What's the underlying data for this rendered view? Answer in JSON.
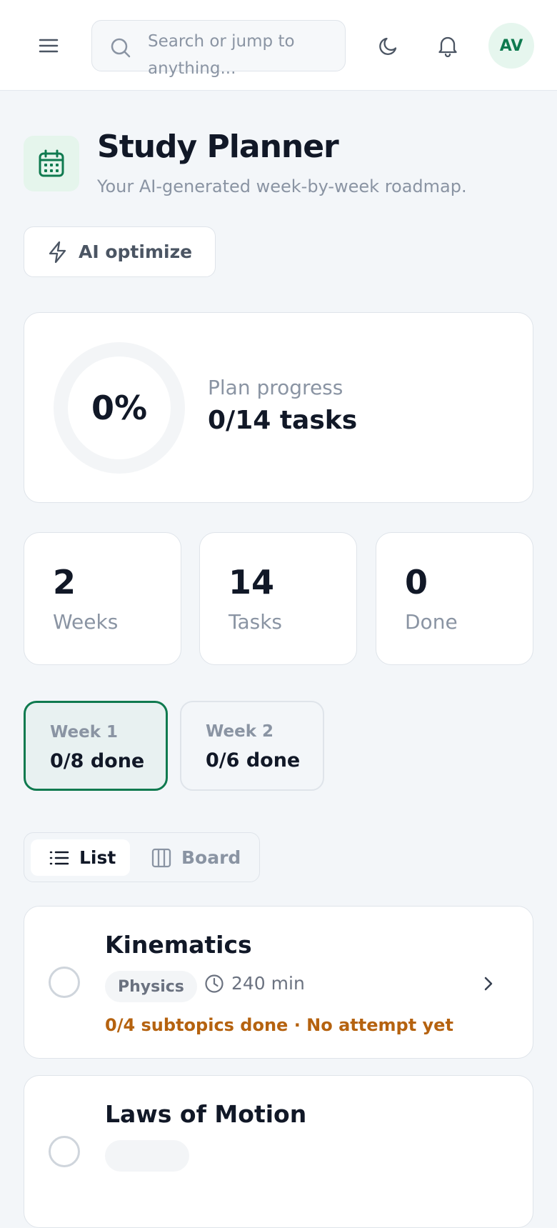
{
  "header": {
    "search_placeholder": "Search or jump to anything...",
    "avatar_initials": "AV"
  },
  "page": {
    "title": "Study Planner",
    "subtitle": "Your AI-generated week-by-week roadmap.",
    "ai_button": "AI optimize"
  },
  "progress": {
    "percent_label": "0%",
    "percent_value": 0,
    "label": "Plan progress",
    "value": "0/14 tasks"
  },
  "stats": [
    {
      "num": "2",
      "label": "Weeks"
    },
    {
      "num": "14",
      "label": "Tasks"
    },
    {
      "num": "0",
      "label": "Done"
    }
  ],
  "weeks": [
    {
      "label": "Week 1",
      "done": "0/8 done",
      "active": true
    },
    {
      "label": "Week 2",
      "done": "0/6 done",
      "active": false
    }
  ],
  "view_toggle": {
    "list": "List",
    "board": "Board",
    "selected": "List"
  },
  "tasks": [
    {
      "name": "Kinematics",
      "tag": "Physics",
      "duration": "240 min",
      "status": "0/4 subtopics done · No attempt yet"
    },
    {
      "name": "Laws of Motion"
    }
  ],
  "colors": {
    "accent": "#0f7a4f",
    "warning": "#b5620f",
    "muted": "#8a94a3"
  }
}
